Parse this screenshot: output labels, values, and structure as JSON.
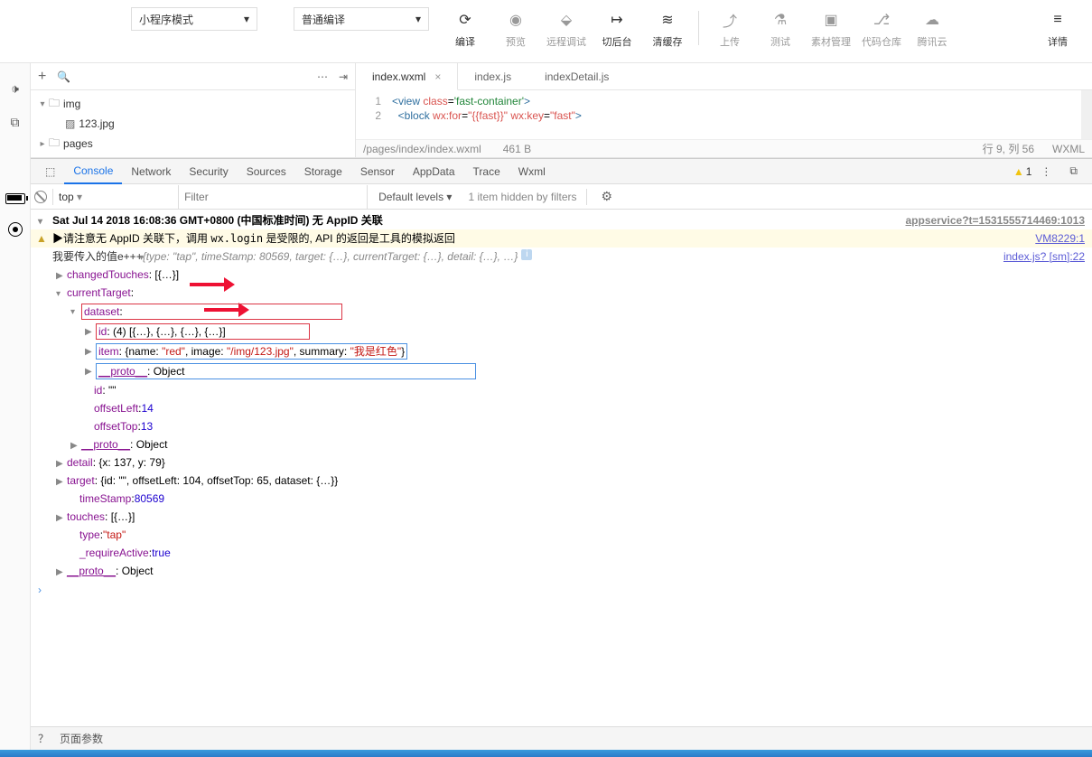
{
  "topbar": {
    "mode_select": "小程序模式",
    "compile_select": "普通编译",
    "buttons": {
      "compile": "编译",
      "preview": "预览",
      "remote_debug": "远程调试",
      "background": "切后台",
      "clear_cache": "清缓存",
      "upload": "上传",
      "test": "测试",
      "material": "素材管理",
      "code_repo": "代码仓库",
      "tencent_cloud": "腾讯云",
      "details": "详情"
    }
  },
  "tree": {
    "folder_img": "img",
    "file_123": "123.jpg",
    "folder_pages": "pages"
  },
  "editor": {
    "tabs": {
      "t1": "index.wxml",
      "t2": "index.js",
      "t3": "indexDetail.js"
    },
    "lines": {
      "l1": {
        "n": "1"
      },
      "l2": {
        "n": "2"
      }
    },
    "status_path": "/pages/index/index.wxml",
    "status_size": "461 B",
    "status_pos": "行 9, 列 56",
    "status_lang": "WXML"
  },
  "devtools": {
    "tabs": {
      "console": "Console",
      "network": "Network",
      "security": "Security",
      "sources": "Sources",
      "storage": "Storage",
      "sensor": "Sensor",
      "appdata": "AppData",
      "trace": "Trace",
      "wxml": "Wxml"
    },
    "warn_count": "1",
    "context": "top",
    "filter_ph": "Filter",
    "level": "Default levels ▾",
    "hidden": "1 item hidden by filters"
  },
  "console": {
    "date": "Sat Jul 14 2018 16:08:36 GMT+0800 (中国标准时间) 无 AppID 关联",
    "date_link": "appservice?t=1531555714469:1013",
    "warn_pre": "▶请注意无 AppID 关联下，调用 ",
    "warn_code": "wx.login",
    "warn_post": " 是受限的, API 的返回是工具的模拟返回",
    "warn_link": "VM8229:1",
    "log_prefix": "我要传入的值e+++ ",
    "log_summary": "{type: \"tap\", timeStamp: 80569, target: {…}, currentTarget: {…}, detail: {…}, …}",
    "log_link": "index.js? [sm]:22",
    "changedTouches": "changedTouches",
    "changedTouches_v": ": [{…}]",
    "currentTarget": "currentTarget",
    "dataset": "dataset",
    "id_key": "id",
    "id_v": ": (4) [{…}, {…}, {…}, {…}]",
    "item_key": "item",
    "item_name": "name",
    "item_name_v": "\"red\"",
    "item_image": "image",
    "item_image_v": "\"/img/123.jpg\"",
    "item_summary": "summary",
    "item_summary_v": "\"我是红色\"",
    "proto": "__proto__",
    "proto_v": ": Object",
    "id2": "id",
    "id2_v": ": \"\"",
    "offsetLeft": "offsetLeft",
    "offsetLeft_v": ": 14",
    "offsetTop": "offsetTop",
    "offsetTop_v": ": 13",
    "detail": "detail",
    "detail_v": ": {x: 137, y: 79}",
    "target": "target",
    "target_v": ": {id: \"\", offsetLeft: 104, offsetTop: 65, dataset: {…}}",
    "timeStamp": "timeStamp",
    "timeStamp_v": ": 80569",
    "touches": "touches",
    "touches_v": ": [{…}]",
    "type": "type",
    "type_v": ": \"tap\"",
    "requireActive": "_requireActive",
    "requireActive_v": ": true"
  },
  "bottom": {
    "b1": "？",
    "b2": "页面参数"
  }
}
